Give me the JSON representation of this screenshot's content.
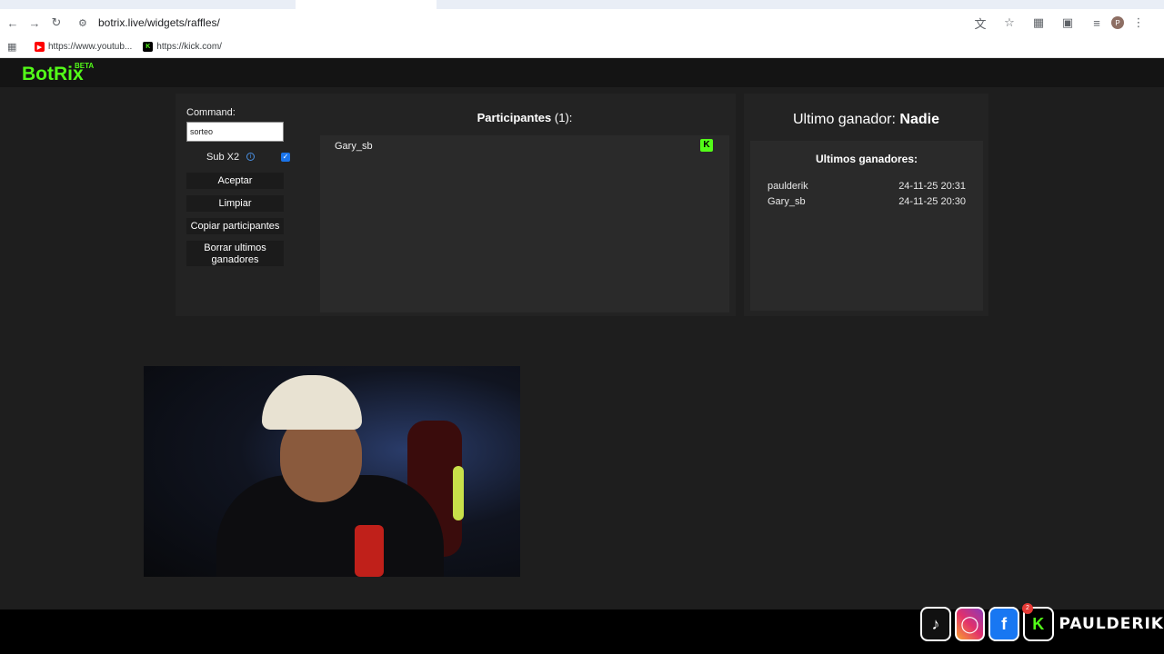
{
  "browser": {
    "url": "botrix.live/widgets/raffles/",
    "bookmarks": [
      {
        "label": "https://www.youtub..."
      },
      {
        "label": "https://kick.com/"
      }
    ],
    "avatar_letter": "P"
  },
  "app": {
    "logo": "BotRix",
    "badge": "BETA",
    "brand_color": "#53fc18"
  },
  "raffle": {
    "command_label": "Command:",
    "command_value": "sorteo",
    "sub_label": "Sub X2",
    "sub_checked": true,
    "buttons": {
      "accept": "Aceptar",
      "clear": "Limpiar",
      "copy": "Copiar participantes",
      "delete_winners": "Borrar ultimos ganadores"
    },
    "participants_title": "Participantes",
    "participants_count": "(1):",
    "participants": [
      {
        "name": "Gary_sb",
        "platform_icon": "kick-icon"
      }
    ]
  },
  "winners": {
    "last_winner_label": "Ultimo ganador:",
    "last_winner_value": "Nadie",
    "list_title": "Ultimos ganadores:",
    "list": [
      {
        "name": "paulderik",
        "date": "24-11-25 20:31"
      },
      {
        "name": "Gary_sb",
        "date": "24-11-25 20:30"
      }
    ]
  },
  "overlay": {
    "social_name": "PAULDERIK",
    "notification_count": "2"
  }
}
